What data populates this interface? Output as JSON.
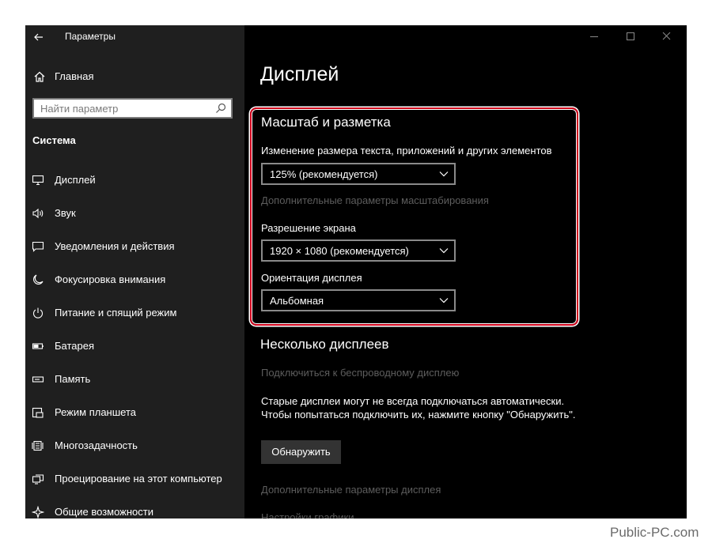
{
  "window": {
    "title": "Параметры"
  },
  "sidebar": {
    "home_label": "Главная",
    "search_placeholder": "Найти параметр",
    "section_label": "Система",
    "items": [
      {
        "label": "Дисплей",
        "icon": "monitor-icon"
      },
      {
        "label": "Звук",
        "icon": "speaker-icon"
      },
      {
        "label": "Уведомления и действия",
        "icon": "notification-icon"
      },
      {
        "label": "Фокусировка внимания",
        "icon": "moon-icon"
      },
      {
        "label": "Питание и спящий режим",
        "icon": "power-icon"
      },
      {
        "label": "Батарея",
        "icon": "battery-icon"
      },
      {
        "label": "Память",
        "icon": "storage-icon"
      },
      {
        "label": "Режим планшета",
        "icon": "tablet-icon"
      },
      {
        "label": "Многозадачность",
        "icon": "multitask-icon"
      },
      {
        "label": "Проецирование на этот компьютер",
        "icon": "project-icon"
      },
      {
        "label": "Общие возможности",
        "icon": "shared-icon"
      }
    ]
  },
  "main": {
    "page_title": "Дисплей",
    "scale_group": {
      "title": "Масштаб и разметка",
      "size_label": "Изменение размера текста, приложений и других элементов",
      "size_value": "125% (рекомендуется)",
      "advanced_scaling_link": "Дополнительные параметры масштабирования",
      "resolution_label": "Разрешение экрана",
      "resolution_value": "1920 × 1080 (рекомендуется)",
      "orientation_label": "Ориентация дисплея",
      "orientation_value": "Альбомная"
    },
    "multi_group": {
      "title": "Несколько дисплеев",
      "wireless_link": "Подключиться к беспроводному дисплею",
      "description": "Старые дисплеи могут не всегда подключаться автоматически. Чтобы попытаться подключить их, нажмите кнопку \"Обнаружить\".",
      "detect_button": "Обнаружить",
      "advanced_display_link": "Дополнительные параметры дисплея",
      "graphics_link": "Настройки графики"
    }
  },
  "colors": {
    "sidebar_bg": "#1f1f1f",
    "main_bg": "#000000",
    "highlight": "#d0021b",
    "muted_text": "#5d5d5d"
  },
  "watermark": "Public-PC.com"
}
